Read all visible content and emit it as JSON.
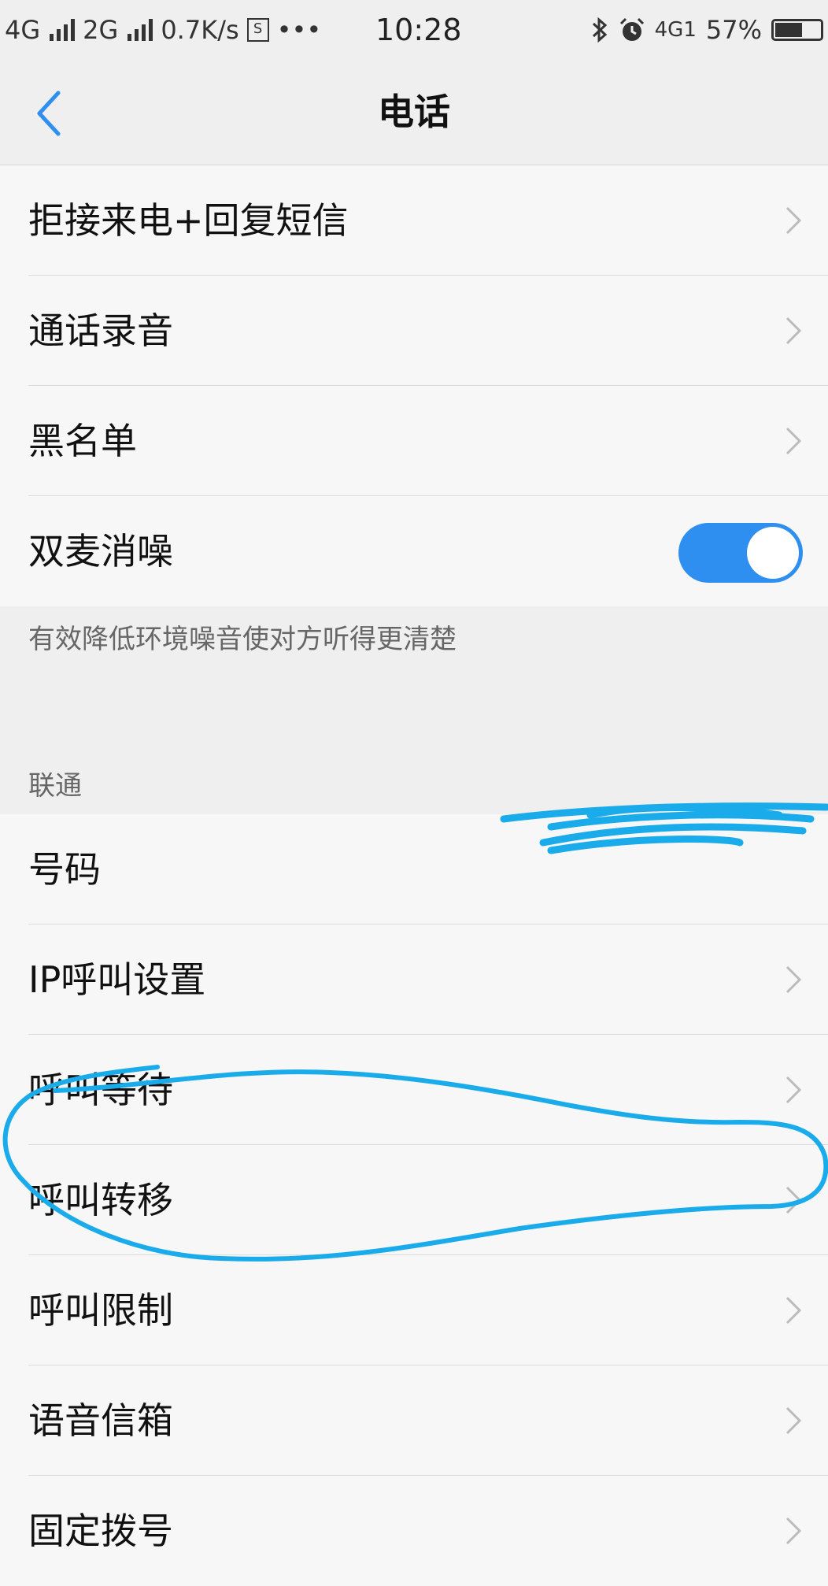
{
  "status_bar": {
    "network1": "4G",
    "network2": "2G",
    "speed": "0.7K/s",
    "sim_badge": "S",
    "dots": "•••",
    "time": "10:28",
    "lte": "4G1",
    "battery": "57%"
  },
  "header": {
    "title": "电话",
    "back_icon": "chevron-left-icon"
  },
  "settings": {
    "reject_sms": "拒接来电+回复短信",
    "call_recording": "通话录音",
    "blacklist": "黑名单",
    "dual_mic": "双麦消噪",
    "dual_mic_enabled": true,
    "dual_mic_desc": "有效降低环境噪音使对方听得更清楚"
  },
  "carrier": {
    "name": "联通",
    "number_label": "号码",
    "number_value": "",
    "items": {
      "ip_call": "IP呼叫设置",
      "call_waiting": "呼叫等待",
      "call_forwarding": "呼叫转移",
      "call_barring": "呼叫限制",
      "voicemail": "语音信箱",
      "fixed_dialing": "固定拨号"
    }
  },
  "colors": {
    "accent": "#2f8ff0",
    "annotation": "#1aabea"
  }
}
